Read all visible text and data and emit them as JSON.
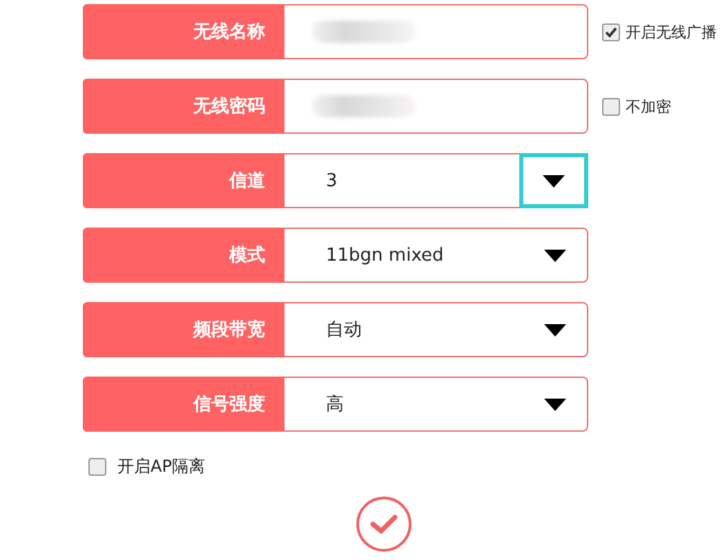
{
  "fields": [
    {
      "kind": "text",
      "label": "无线名称",
      "value_obscured": true,
      "option": {
        "label": "开启无线广播",
        "checked": true
      }
    },
    {
      "kind": "text",
      "label": "无线密码",
      "value_obscured": true,
      "option": {
        "label": "不加密",
        "checked": false
      }
    },
    {
      "kind": "select",
      "label": "信道",
      "value": "3",
      "focused": true
    },
    {
      "kind": "select",
      "label": "模式",
      "value": "11bgn mixed",
      "focused": false
    },
    {
      "kind": "select",
      "label": "频段带宽",
      "value": "自动",
      "focused": false
    },
    {
      "kind": "select",
      "label": "信号强度",
      "value": "高",
      "focused": false
    }
  ],
  "ap_isolation": {
    "label": "开启AP隔离",
    "checked": false
  }
}
